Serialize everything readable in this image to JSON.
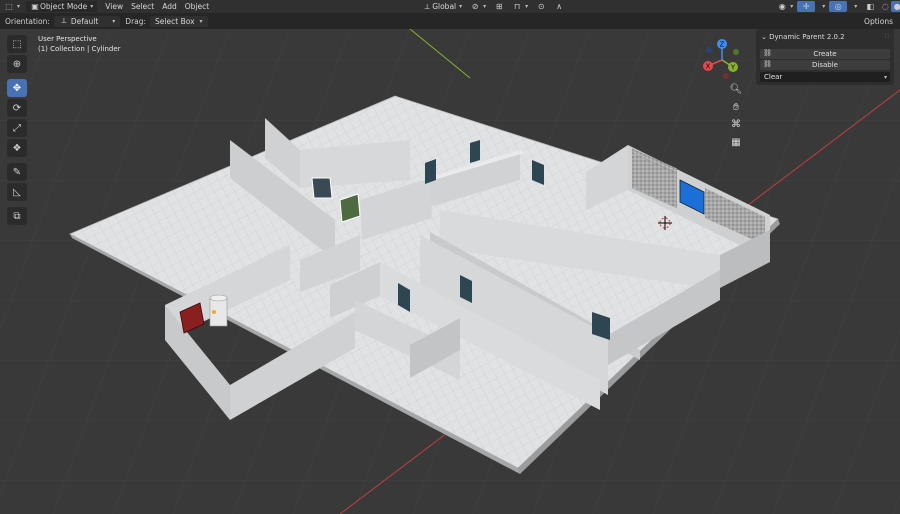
{
  "header": {
    "mode": "Object Mode",
    "menus": [
      "View",
      "Select",
      "Add",
      "Object"
    ],
    "transform_orientation": "Global"
  },
  "tool_settings": {
    "orientation_label": "Orientation:",
    "orientation_value": "Default",
    "drag_label": "Drag:",
    "drag_value": "Select Box",
    "options_label": "Options"
  },
  "viewport": {
    "view_name": "User Perspective",
    "selection_info": "(1) Collection | Cylinder"
  },
  "toolbar": {
    "tools": [
      "select-box",
      "cursor",
      "move",
      "rotate",
      "scale",
      "transform",
      "annotate",
      "measure",
      "add-cube"
    ],
    "active_tool": "move"
  },
  "gizmo": {
    "x": "X",
    "y": "Y",
    "z": "Z"
  },
  "panel": {
    "title": "Dynamic Parent 2.0.2",
    "create_label": "Create",
    "disable_label": "Disable",
    "clear_value": "Clear"
  },
  "colors": {
    "accent": "#4772b3",
    "axis_x": "#e5484d",
    "axis_y": "#86b32d",
    "axis_z": "#3f8ef5",
    "floor": "#e0e1e2",
    "wall": "#d6d7d8",
    "door_red": "#8a1f1f",
    "door_blue": "#1c6fd6"
  }
}
